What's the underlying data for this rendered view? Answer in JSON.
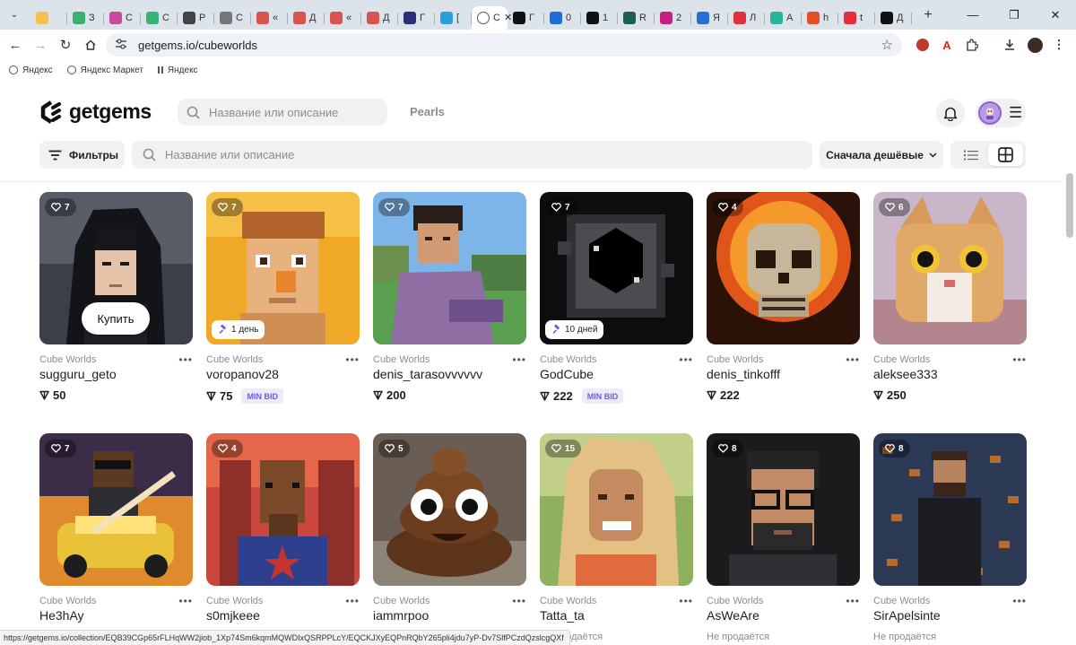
{
  "browser": {
    "tabs": [
      {
        "label": "",
        "color": "#f2c14e"
      },
      {
        "label": "З",
        "color": "#3bb273"
      },
      {
        "label": "С",
        "color": "#c84b9e"
      },
      {
        "label": "С",
        "color": "#3bb273"
      },
      {
        "label": "Р",
        "color": "#444444"
      },
      {
        "label": "С",
        "color": "#777777"
      },
      {
        "label": "«",
        "color": "#d9534f"
      },
      {
        "label": "Д",
        "color": "#d9534f"
      },
      {
        "label": "«",
        "color": "#d9534f"
      },
      {
        "label": "Д",
        "color": "#d9534f"
      },
      {
        "label": "Г",
        "color": "#2b2f77"
      },
      {
        "label": "[",
        "color": "#2aa0da"
      },
      {
        "label": "С",
        "color": "#ffffff",
        "active": true
      },
      {
        "label": "Г",
        "color": "#111111"
      },
      {
        "label": "0",
        "color": "#1d6fd6"
      },
      {
        "label": "1",
        "color": "#111111"
      },
      {
        "label": "R",
        "color": "#1b5e55"
      },
      {
        "label": "2",
        "color": "#c8207f"
      },
      {
        "label": "Я",
        "color": "#2b6fd6"
      },
      {
        "label": "Л",
        "color": "#e0303b"
      },
      {
        "label": "А",
        "color": "#2bb39a"
      },
      {
        "label": "h",
        "color": "#e44d26"
      },
      {
        "label": "t",
        "color": "#e0303b"
      },
      {
        "label": "Д",
        "color": "#111111"
      }
    ],
    "url": "getgems.io/cubeworlds",
    "bookmarks": [
      {
        "label": "Яндекс"
      },
      {
        "label": "Яндекс Маркет"
      },
      {
        "label": "Яндекс"
      }
    ],
    "status_url": "https://getgems.io/collection/EQB39CGp65rFLHqWW2jiob_1Xp74Sm6kqmMQWDIxQSRPPLcY/EQCKJXyEQPnRQbY265pli4jdu7yP-Dv7SlfPCzdQzslcgQXf"
  },
  "header": {
    "logo_text": "getgems",
    "search_placeholder": "Название или описание",
    "pearls_label": "Pearls"
  },
  "toolbar": {
    "filters_label": "Фильтры",
    "search_placeholder": "Название или описание",
    "sort_label": "Сначала дешёвые"
  },
  "cards": [
    {
      "likes": "7",
      "collection": "Cube Worlds",
      "name": "sugguru_geto",
      "price": "50",
      "buy_label": "Купить",
      "art": "samurai"
    },
    {
      "likes": "7",
      "collection": "Cube Worlds",
      "name": "voropanov28",
      "price": "75",
      "min_bid": "MIN BID",
      "timer": "1 день",
      "art": "blockhead"
    },
    {
      "likes": "7",
      "collection": "Cube Worlds",
      "name": "denis_tarasovvvvvv",
      "price": "200",
      "art": "man-in-field"
    },
    {
      "likes": "7",
      "collection": "Cube Worlds",
      "name": "GodCube",
      "price": "222",
      "min_bid": "MIN BID",
      "timer": "10 дней",
      "art": "void-cube"
    },
    {
      "likes": "4",
      "collection": "Cube Worlds",
      "name": "denis_tinkofff",
      "price": "222",
      "art": "flaming-skull"
    },
    {
      "likes": "6",
      "collection": "Cube Worlds",
      "name": "aleksee333",
      "price": "250",
      "art": "cat"
    },
    {
      "likes": "7",
      "collection": "Cube Worlds",
      "name": "He3hAy",
      "art": "guitar-car"
    },
    {
      "likes": "4",
      "collection": "Cube Worlds",
      "name": "s0mjkeee",
      "art": "horse"
    },
    {
      "likes": "5",
      "collection": "Cube Worlds",
      "name": "iammrpoo",
      "art": "poo"
    },
    {
      "likes": "15",
      "collection": "Cube Worlds",
      "name": "Tatta_ta",
      "status": "Не продаётся",
      "art": "woman"
    },
    {
      "likes": "8",
      "collection": "Cube Worlds",
      "name": "AsWeAre",
      "status": "Не продаётся",
      "art": "glasses-man"
    },
    {
      "likes": "8",
      "collection": "Cube Worlds",
      "name": "SirApelsinte",
      "status": "Не продаётся",
      "art": "dark-man"
    }
  ]
}
